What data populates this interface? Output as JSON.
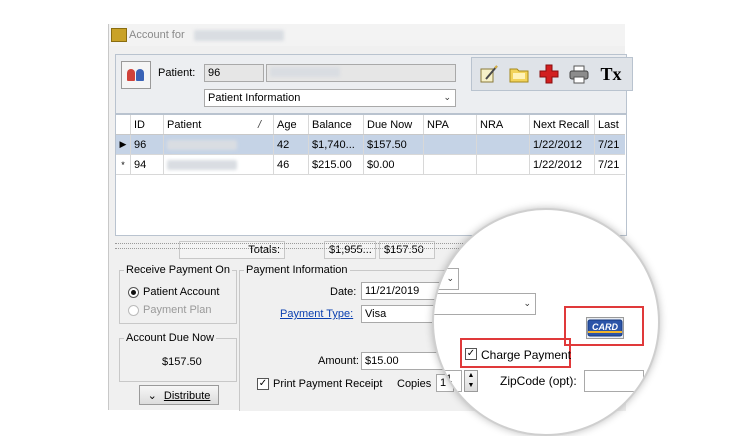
{
  "window": {
    "title_prefix": "Account for"
  },
  "patient_bar": {
    "patient_label": "Patient:",
    "patient_id": "96",
    "view_select": "Patient Information"
  },
  "toolbar": {
    "icons": [
      "edit-icon",
      "folder-icon",
      "medical-cross-icon",
      "printer-icon",
      "tx-icon"
    ],
    "tx_label": "Tx"
  },
  "grid": {
    "columns": [
      "ID",
      "Patient",
      "/",
      "Age",
      "Balance",
      "Due Now",
      "NPA",
      "NRA",
      "Next Recall",
      "Last"
    ],
    "rows": [
      {
        "indicator": "▶",
        "id": "96",
        "age": "42",
        "balance": "$1,740...",
        "due_now": "$157.50",
        "npa": "",
        "nra": "",
        "next_recall": "1/22/2012",
        "last": "7/21"
      },
      {
        "indicator": "*",
        "id": "94",
        "age": "46",
        "balance": "$215.00",
        "due_now": "$0.00",
        "npa": "",
        "nra": "",
        "next_recall": "1/22/2012",
        "last": "7/21"
      }
    ],
    "totals_label": "Totals:",
    "totals_balance": "$1,955...",
    "totals_due_now": "$157.50"
  },
  "receive_payment": {
    "title": "Receive Payment On",
    "option_account": "Patient Account",
    "option_plan": "Payment Plan"
  },
  "account_due": {
    "title": "Account Due Now",
    "value": "$157.50"
  },
  "distribute_button": "Distribute",
  "payment_info": {
    "title": "Payment Information",
    "date_label": "Date:",
    "date_value": "11/21/2019",
    "type_label": "Payment Type:",
    "type_value": "Visa",
    "amount_label": "Amount:",
    "amount_value": "$15.00",
    "print_receipt_label": "Print Payment Receipt",
    "copies_label": "Copies",
    "copies_value": "1"
  },
  "zoom": {
    "charge_payment_label": "Charge Payment",
    "card_label": "CARD",
    "copies_value": "1",
    "zipcode_label": "ZipCode (opt):"
  },
  "colors": {
    "selection_row": "#c5d3e6",
    "highlight_red": "#e0393a",
    "link_blue": "#0a3fb0"
  }
}
